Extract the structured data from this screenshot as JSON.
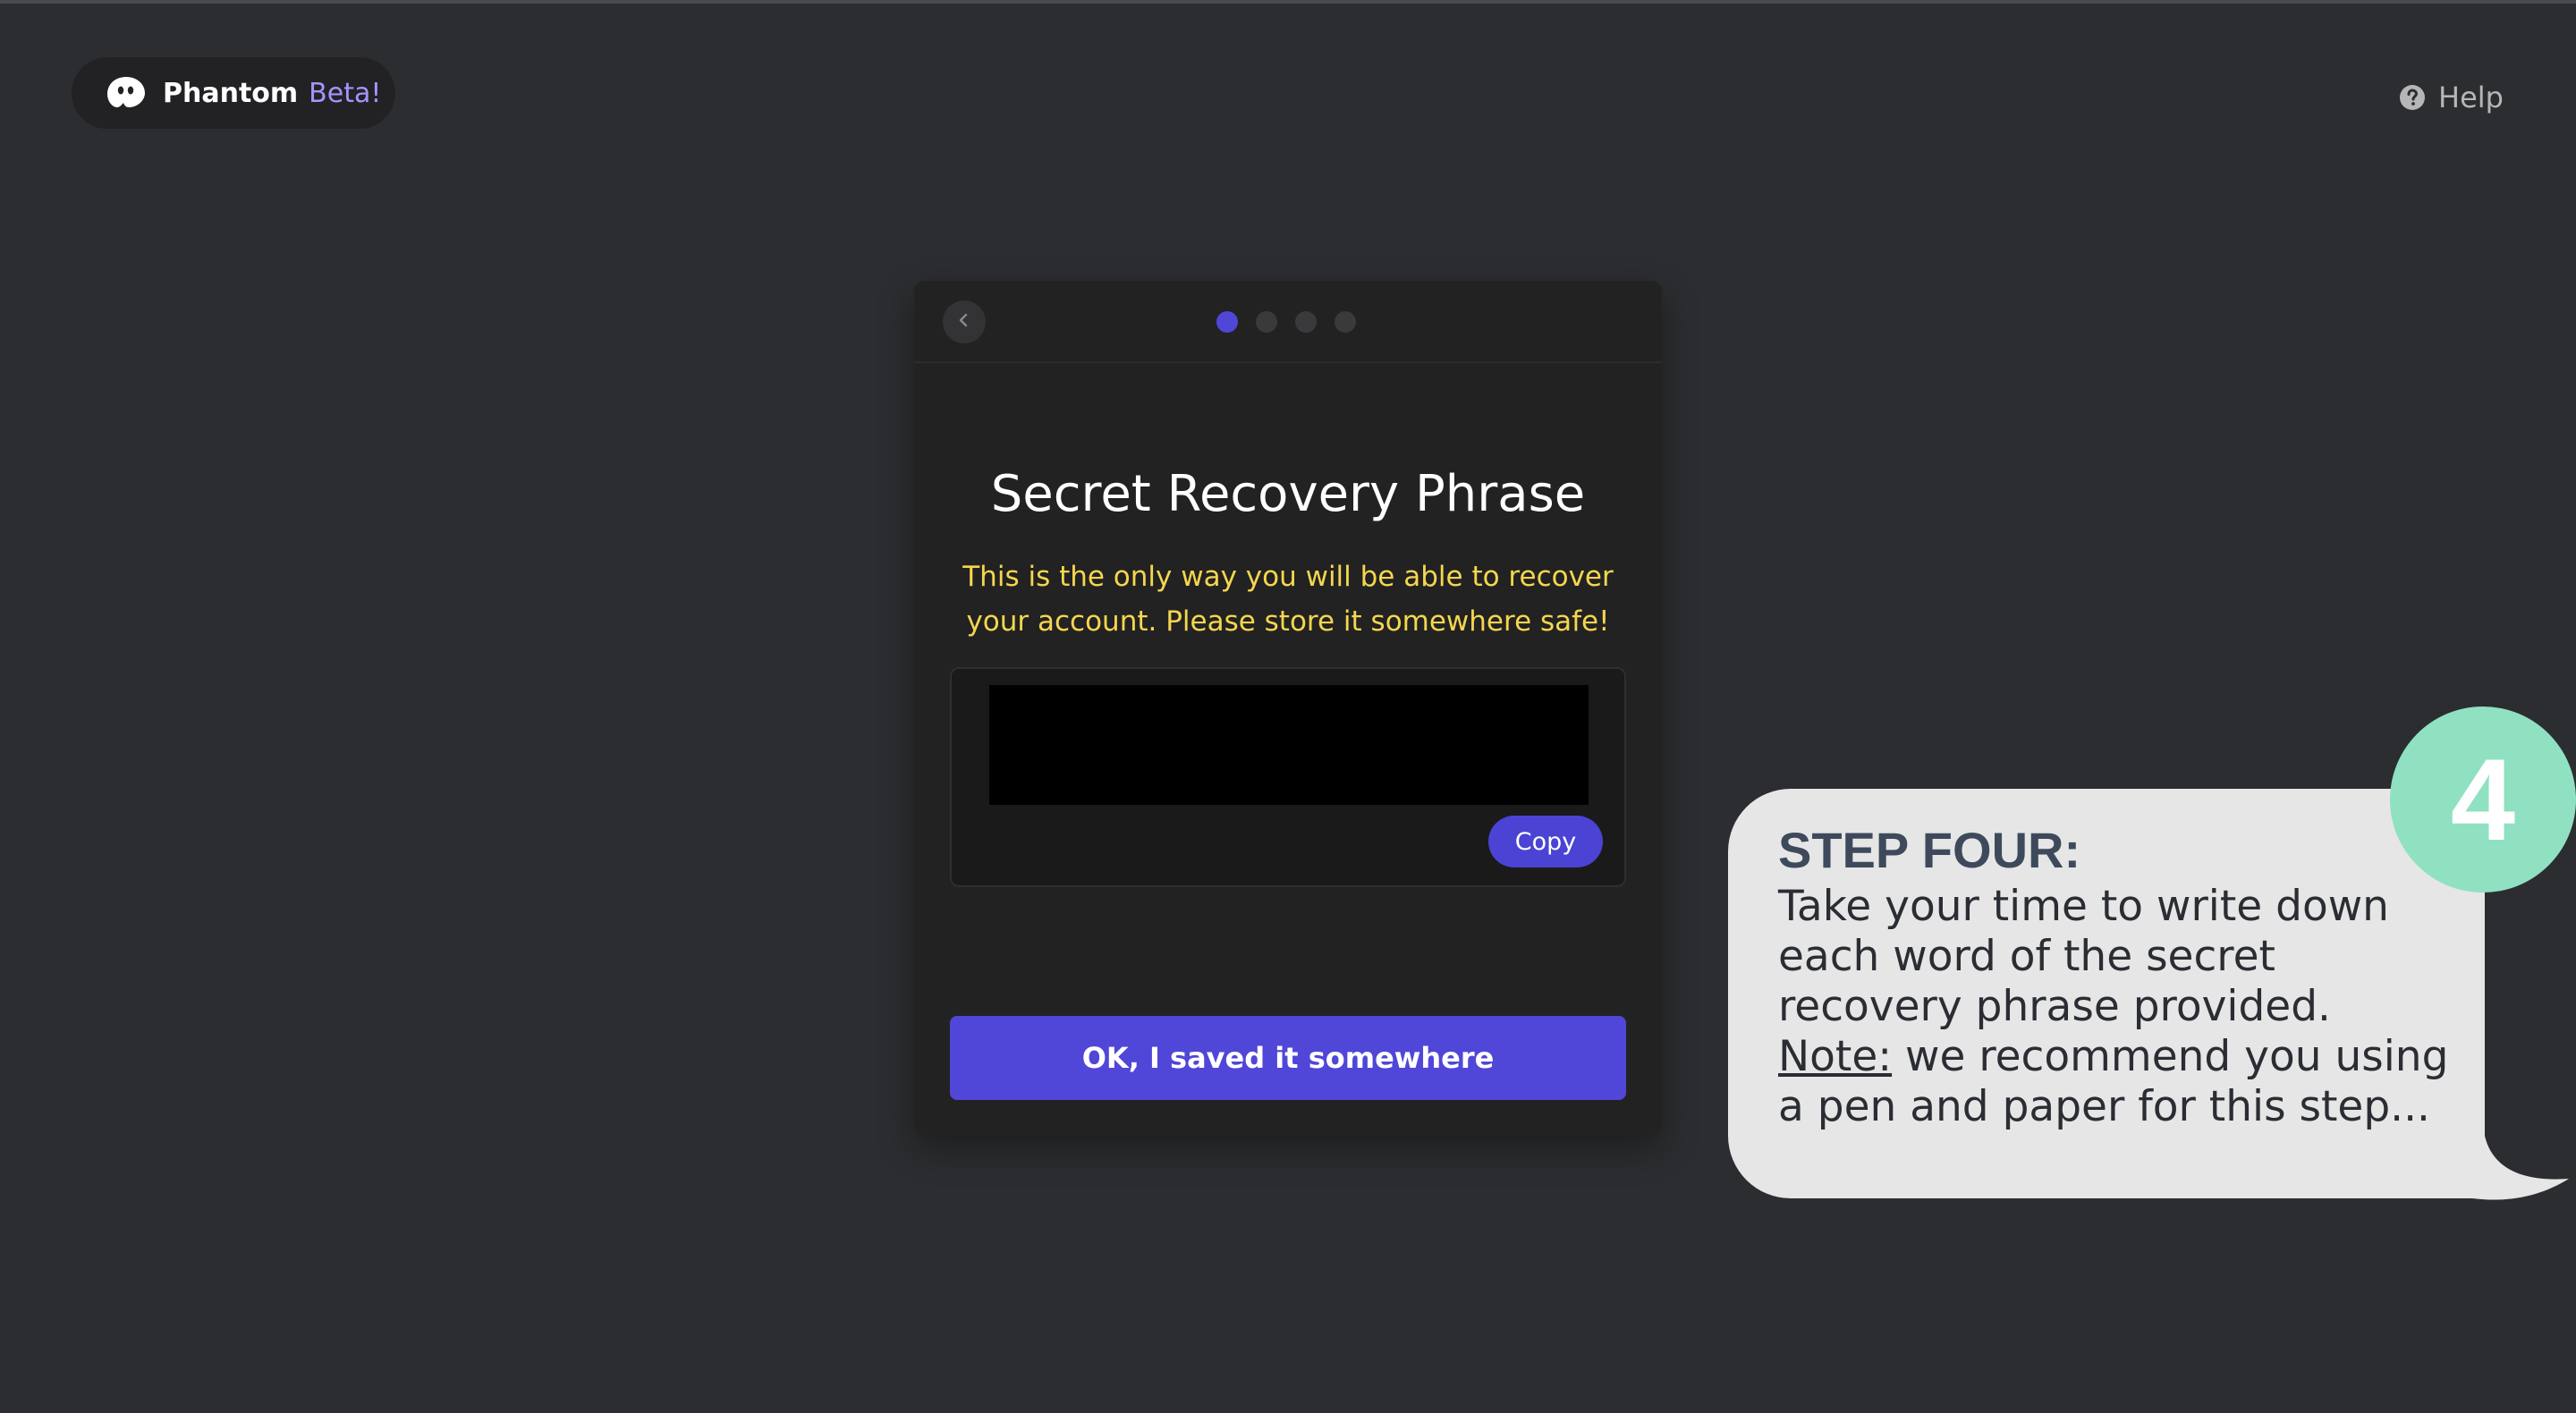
{
  "brand": {
    "name": "Phantom",
    "badge": "Beta!",
    "logo_icon": "phantom-ghost-icon"
  },
  "help": {
    "label": "Help",
    "icon": "question-circle-icon"
  },
  "modal": {
    "back_icon": "chevron-left-icon",
    "steps": {
      "total": 4,
      "current": 1
    },
    "title": "Secret Recovery Phrase",
    "warning": "This is the only way you will be able to recover your account. Please store it somewhere safe!",
    "phrase_redacted": true,
    "copy_label": "Copy",
    "confirm_label": "OK, I saved it somewhere"
  },
  "callout": {
    "badge_number": "4",
    "heading": "STEP FOUR:",
    "body": "Take your time to write down each word of the secret recovery phrase provided.",
    "note_label": "Note:",
    "note_text": " we recommend you using a pen and paper for this step..."
  },
  "colors": {
    "background": "#2c2d30",
    "accent": "#5046d8",
    "warning": "#f5d64e",
    "beta": "#a495ff",
    "callout_badge": "#8fe1c2"
  }
}
